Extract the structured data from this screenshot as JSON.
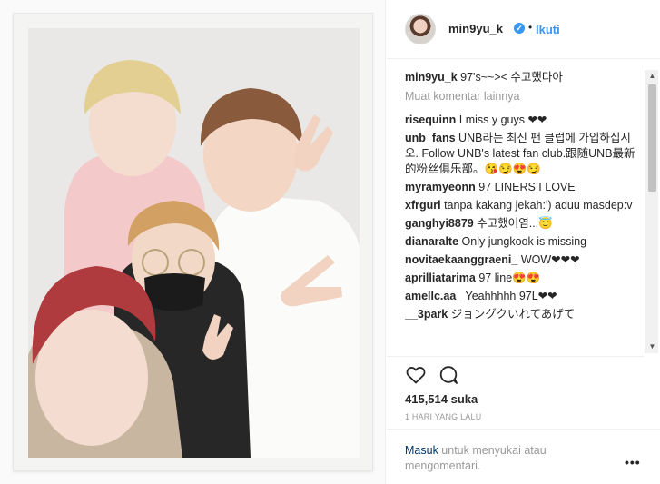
{
  "post": {
    "username": "min9yu_k",
    "follow_label": "Ikuti",
    "dot": "•",
    "verified_mark": "✓",
    "caption_text": "97's~~>< 수고했다아",
    "more_comments_label": "Muat komentar lainnya",
    "likes": "415,514 suka",
    "time": "1 HARI YANG LALU",
    "login_link": "Masuk",
    "login_text": " untuk menyukai atau mengomentari.",
    "more_options": "•••"
  },
  "comments": [
    {
      "user": "risequinn",
      "text": "I miss y guys ❤❤"
    },
    {
      "user": "unb_fans",
      "text": "UNB라는 최신 팬 클럽에 가입하십시오. Follow UNB's latest fan club.跟随UNB最新的粉丝俱乐部。😘😏😍😏"
    },
    {
      "user": "myramyeonn",
      "text": "97 LINERS I LOVE"
    },
    {
      "user": "xfrgurl",
      "text": "tanpa kakang jekah:') aduu masdep:v"
    },
    {
      "user": "ganghyi8879",
      "text": "수고했어염...😇"
    },
    {
      "user": "dianaralte",
      "text": "Only jungkook is missing"
    },
    {
      "user": "novitaekaanggraeni_",
      "text": "WOW❤❤❤"
    },
    {
      "user": "aprilliatarima",
      "text": "97 line😍😍"
    },
    {
      "user": "amellc.aa_",
      "text": "Yeahhhhh 97L❤❤"
    },
    {
      "user": "__3park",
      "text": "ジョングクいれてあげて"
    }
  ],
  "icons": {
    "heart": "heart-icon",
    "comment": "comment-icon",
    "verified": "verified-badge-icon"
  },
  "colors": {
    "link": "#3897f0",
    "text": "#262626",
    "muted": "#999999"
  }
}
